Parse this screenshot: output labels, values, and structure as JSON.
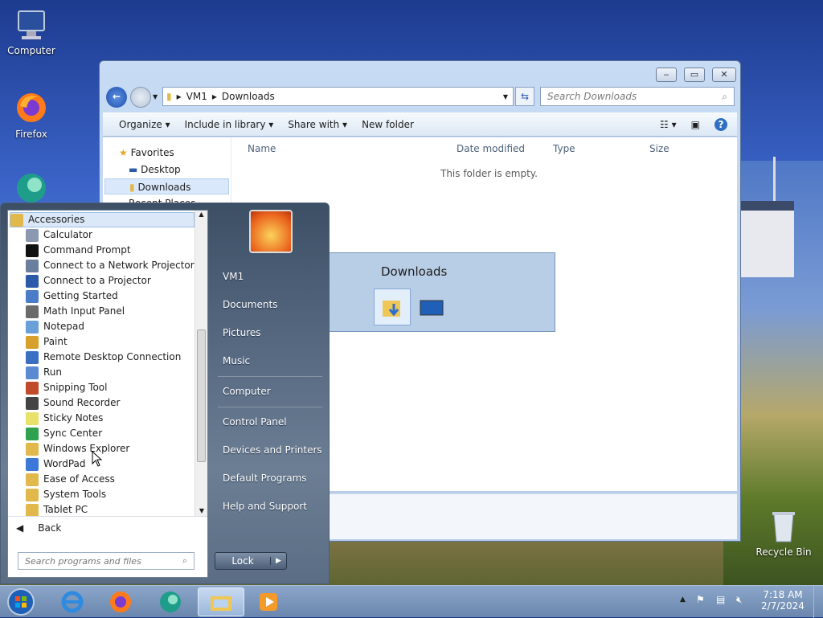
{
  "desktop": {
    "icons": [
      {
        "label": "Computer"
      },
      {
        "label": "Firefox"
      },
      {
        "label": "Recycle Bin"
      }
    ]
  },
  "explorer": {
    "address": {
      "parts": [
        "VM1",
        "Downloads"
      ]
    },
    "search_placeholder": "Search Downloads",
    "toolbar": {
      "organize": "Organize",
      "include": "Include in library",
      "share": "Share with",
      "new_folder": "New folder"
    },
    "nav": {
      "favorites": "Favorites",
      "desktop": "Desktop",
      "downloads": "Downloads",
      "recent": "Recent Places"
    },
    "columns": {
      "name": "Name",
      "date": "Date modified",
      "type": "Type",
      "size": "Size"
    },
    "empty_text": "This folder is empty."
  },
  "popup": {
    "title": "Downloads"
  },
  "start_menu": {
    "programs": [
      "Accessories",
      "Calculator",
      "Command Prompt",
      "Connect to a Network Projector",
      "Connect to a Projector",
      "Getting Started",
      "Math Input Panel",
      "Notepad",
      "Paint",
      "Remote Desktop Connection",
      "Run",
      "Snipping Tool",
      "Sound Recorder",
      "Sticky Notes",
      "Sync Center",
      "Windows Explorer",
      "WordPad",
      "Ease of Access",
      "System Tools",
      "Tablet PC"
    ],
    "back": "Back",
    "search_placeholder": "Search programs and files",
    "right": [
      "VM1",
      "Documents",
      "Pictures",
      "Music",
      "Computer",
      "Control Panel",
      "Devices and Printers",
      "Default Programs",
      "Help and Support"
    ],
    "lock": "Lock"
  },
  "taskbar": {
    "time": "7:18 AM",
    "date": "2/7/2024"
  }
}
